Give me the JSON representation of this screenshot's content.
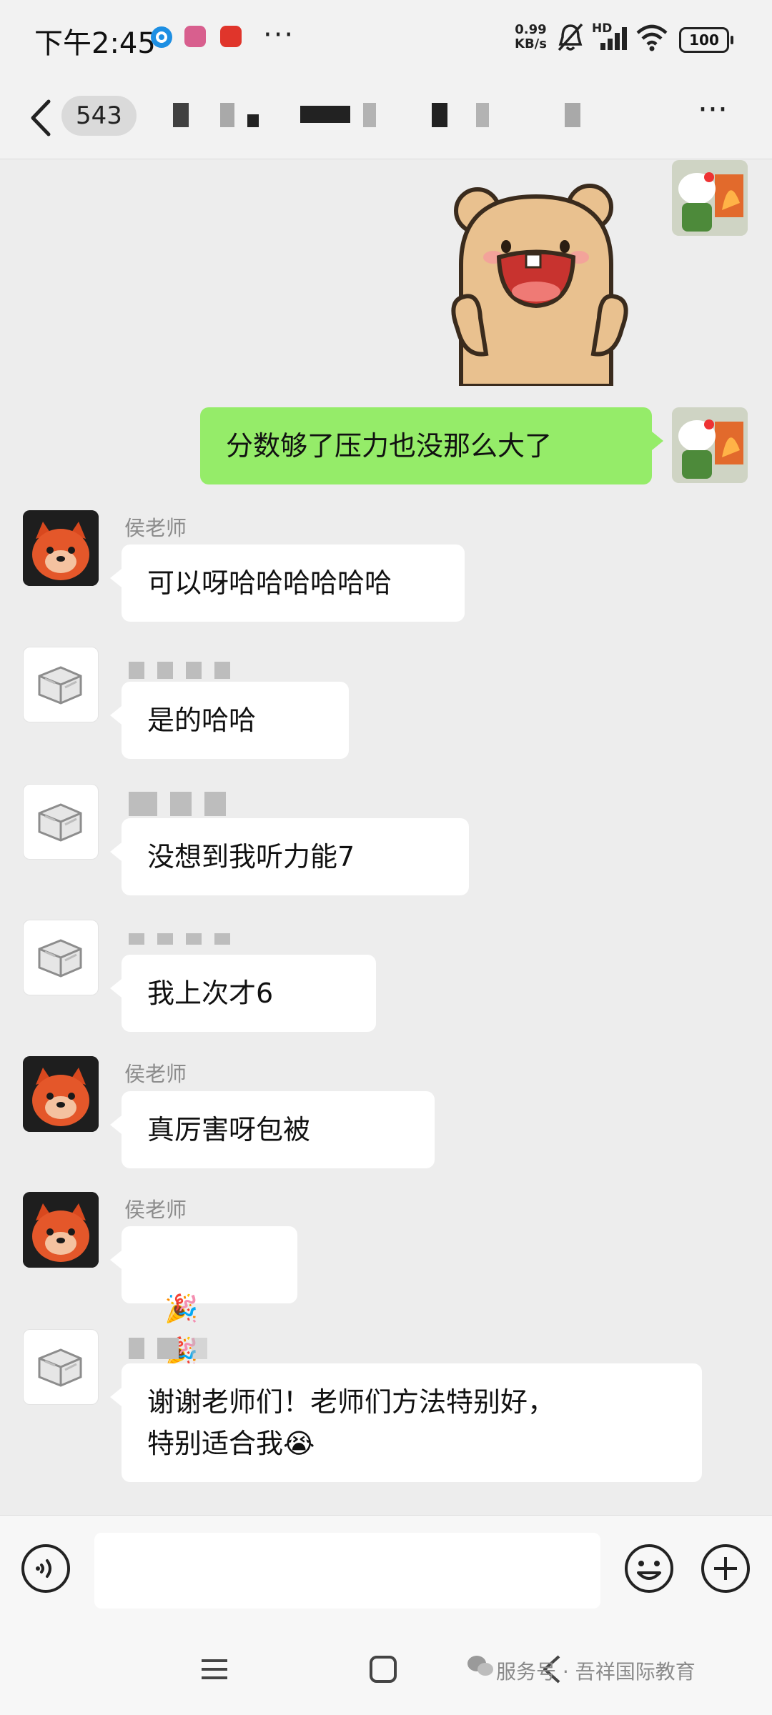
{
  "status_bar": {
    "time": "下午2:45",
    "more": "···",
    "net_speed_value": "0.99",
    "net_speed_unit": "KB/s",
    "network_tag": "HD",
    "battery": "100"
  },
  "header": {
    "unread_count": "543"
  },
  "messages": [
    {
      "text": "分数够了压力也没那么大了"
    },
    {
      "sender": "侯老师",
      "text": "可以呀哈哈哈哈哈哈"
    },
    {
      "text": "是的哈哈"
    },
    {
      "text": "没想到我听力能7"
    },
    {
      "text": "我上次才6"
    },
    {
      "sender": "侯老师",
      "text": "真厉害呀包被"
    },
    {
      "sender": "侯老师",
      "emojis": [
        "🎉",
        "🎉",
        "🎉"
      ]
    },
    {
      "text": "谢谢老师们！老师们方法特别好，\n特别适合我",
      "emoji": "😭"
    }
  ],
  "watermark": "服务号 · 吾祥国际教育",
  "colors": {
    "chat_bg": "#ededed",
    "bubble_out": "#95ec69",
    "bubble_in": "#ffffff"
  }
}
